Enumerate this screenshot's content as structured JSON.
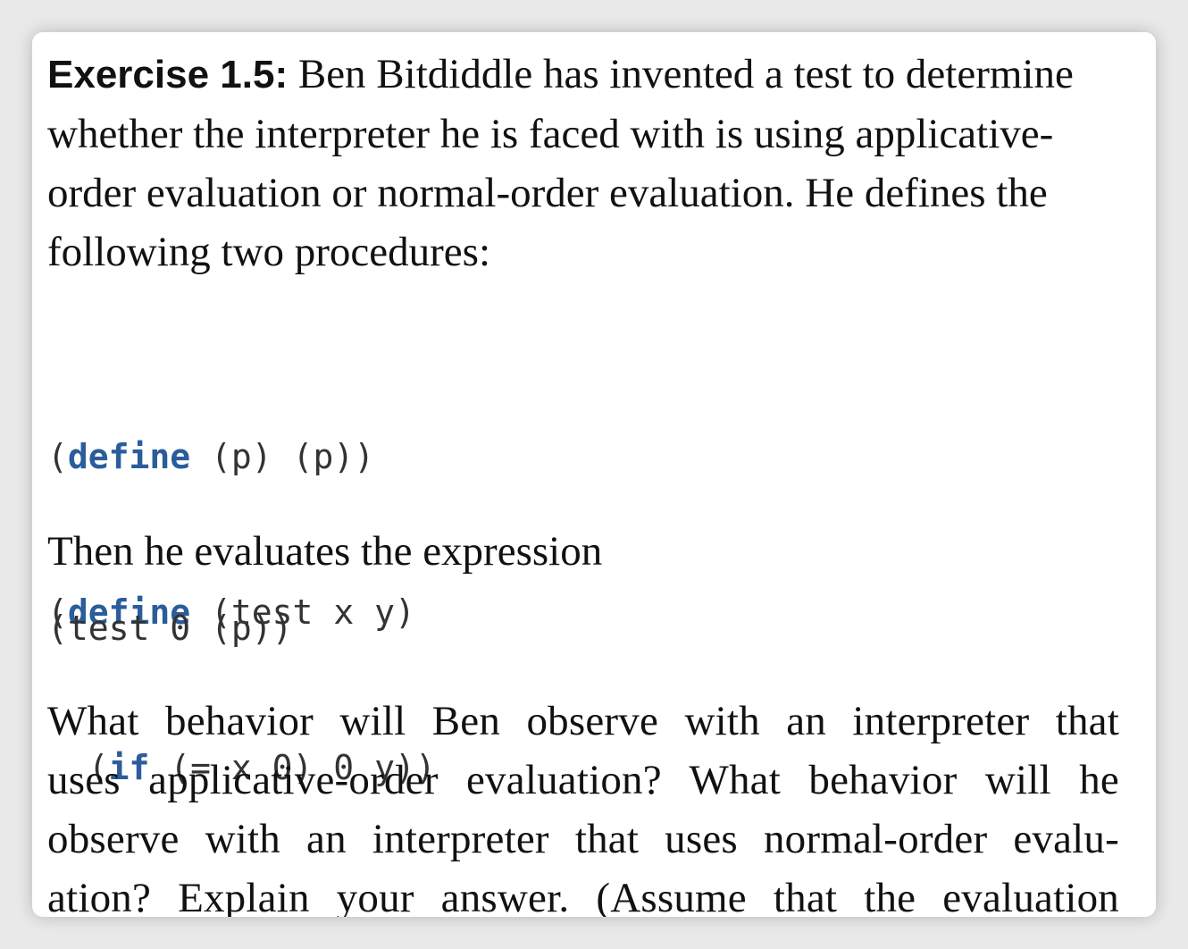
{
  "exercise": {
    "label": "Exercise 1.5:",
    "intro_lines": [
      " Ben Bitdiddle has invented a test to determine",
      "whether the interpreter he is faced with is using applicative-",
      "order evaluation or normal-order evaluation. He defines the",
      "following two procedures:"
    ],
    "code_block_1": [
      {
        "pre": "(",
        "kw": "define",
        "post": " (p) (p))"
      },
      {
        "pre": "(",
        "kw": "define",
        "post": " (test x y)"
      },
      {
        "pre": "  (",
        "kw": "if",
        "post": " (= x 0) 0 y))"
      }
    ],
    "then_text": "Then he evaluates the expression",
    "code_block_2": "(test 0 (p))",
    "question_lines": [
      "What behavior will Ben observe with an interpreter that",
      "uses applicative-order evaluation? What behavior will he",
      "observe with an interpreter that uses normal-order evalu-",
      "ation? Explain your answer. (Assume that the evaluation"
    ]
  },
  "colors": {
    "keyword": "#2a5d9a",
    "code_text": "#333333",
    "body_text": "#111111"
  }
}
